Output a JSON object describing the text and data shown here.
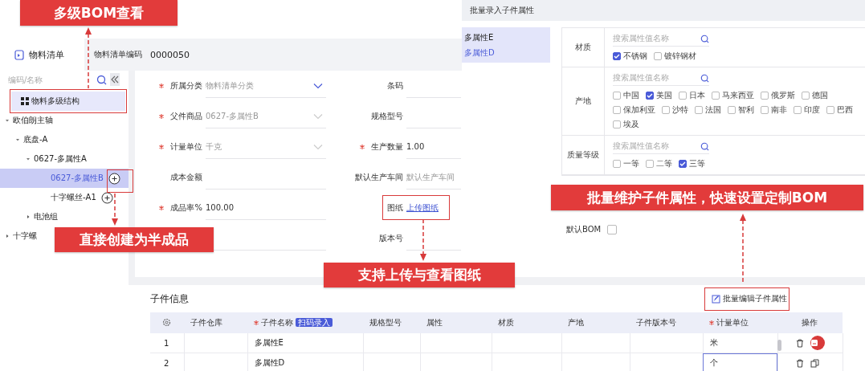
{
  "callouts": [
    {
      "text": "多级BOM查看"
    },
    {
      "text": "直接创建为半成品"
    },
    {
      "text": "支持上传与查看图纸"
    },
    {
      "text": "批量维护子件属性，快速设置定制BOM"
    }
  ],
  "header": {
    "tab": "物料清单",
    "code_label": "物料清单编码",
    "code": "0000050"
  },
  "sidebar": {
    "search_placeholder": "编码/名称",
    "root": {
      "label": "物料多级结构",
      "selected": true
    },
    "tree": [
      {
        "label": "欧伯朗主轴",
        "selected": false,
        "expanded": true,
        "children": [
          {
            "label": "底盘-A",
            "selected": false,
            "expanded": true,
            "children": [
              {
                "label": "0627-多属性A",
                "selected": false,
                "expanded": true,
                "children": [
                  {
                    "label": "0627-多属性B",
                    "selected": true,
                    "add": true
                  },
                  {
                    "label": "十字螺丝-A1",
                    "selected": false,
                    "add": true
                  }
                ]
              },
              {
                "label": "电池组",
                "selected": false,
                "expanded": false
              }
            ]
          }
        ]
      },
      {
        "label": "十字螺",
        "selected": false,
        "expanded": false
      }
    ]
  },
  "form": [
    {
      "label": "所属分类",
      "required": true,
      "kind": "select",
      "placeholder": "物料清单分类"
    },
    {
      "label": "条码",
      "required": false,
      "kind": "text"
    },
    {
      "label": "父件商品",
      "required": true,
      "kind": "select",
      "value": "0627-多属性B",
      "disabled": true
    },
    {
      "label": "规格型号",
      "required": false,
      "kind": "text"
    },
    {
      "label": "计量单位",
      "required": true,
      "kind": "select",
      "value": "千克",
      "disabled": true
    },
    {
      "label": "生产数量",
      "required": true,
      "kind": "text",
      "value": "1.00"
    },
    {
      "label": "成本金额",
      "required": false,
      "kind": "text"
    },
    {
      "label": "默认生产车间",
      "required": false,
      "kind": "text",
      "placeholder": "默认生产车间"
    },
    {
      "label": "成品率%",
      "required": true,
      "kind": "text",
      "value": "100.00"
    },
    {
      "label": "图纸",
      "required": false,
      "kind": "link",
      "value": "上传图纸"
    },
    {
      "kind": "text"
    },
    {
      "label": "版本号",
      "required": false,
      "kind": "text"
    }
  ],
  "dialog": {
    "title": "批量录入子件属性",
    "items": [
      {
        "label": "多属性E",
        "selected": false
      },
      {
        "label": "多属性D",
        "selected": true
      }
    ],
    "groups": [
      {
        "label": "材质",
        "search_placeholder": "搜索属性值名称",
        "options": [
          {
            "label": "不锈钢",
            "checked": true
          },
          {
            "label": "镀锌钢材",
            "checked": false
          }
        ]
      },
      {
        "label": "产地",
        "search_placeholder": "搜索属性值名称",
        "options": [
          {
            "label": "中国",
            "checked": false
          },
          {
            "label": "美国",
            "checked": true
          },
          {
            "label": "日本",
            "checked": false
          },
          {
            "label": "马来西亚",
            "checked": false
          },
          {
            "label": "俄罗斯",
            "checked": false
          },
          {
            "label": "德国",
            "checked": false
          },
          {
            "label": "保加利亚",
            "checked": false
          },
          {
            "label": "沙特",
            "checked": false
          },
          {
            "label": "法国",
            "checked": false
          },
          {
            "label": "智利",
            "checked": false
          },
          {
            "label": "南非",
            "checked": false
          },
          {
            "label": "印度",
            "checked": false
          },
          {
            "label": "巴西",
            "checked": false
          },
          {
            "label": "埃及",
            "checked": false
          }
        ]
      },
      {
        "label": "质量等级",
        "search_placeholder": "搜索属性值名称",
        "options": [
          {
            "label": "一等",
            "checked": false
          },
          {
            "label": "二等",
            "checked": false
          },
          {
            "label": "三等",
            "checked": true
          }
        ]
      }
    ],
    "default_bom": {
      "label": "默认BOM",
      "checked": false
    }
  },
  "components": {
    "title": "子件信息",
    "batch_button": "批量编辑子件属性",
    "scan_badge": "扫码录入",
    "columns": [
      {
        "label": "子件仓库",
        "required": false
      },
      {
        "label": "子件名称",
        "required": true,
        "badge": true
      },
      {
        "label": "规格型号",
        "required": false
      },
      {
        "label": "属性",
        "required": false
      },
      {
        "label": "材质",
        "required": false
      },
      {
        "label": "产地",
        "required": false
      },
      {
        "label": "子件版本号",
        "required": false
      },
      {
        "label": "计量单位",
        "required": true
      },
      {
        "label": "操作",
        "required": false
      }
    ],
    "rows": [
      {
        "index": "1",
        "name": "多属性E",
        "unit": "米",
        "editing": false,
        "highlight": true
      },
      {
        "index": "2",
        "name": "多属性D",
        "unit": "个",
        "editing": true,
        "highlight": false
      }
    ]
  }
}
